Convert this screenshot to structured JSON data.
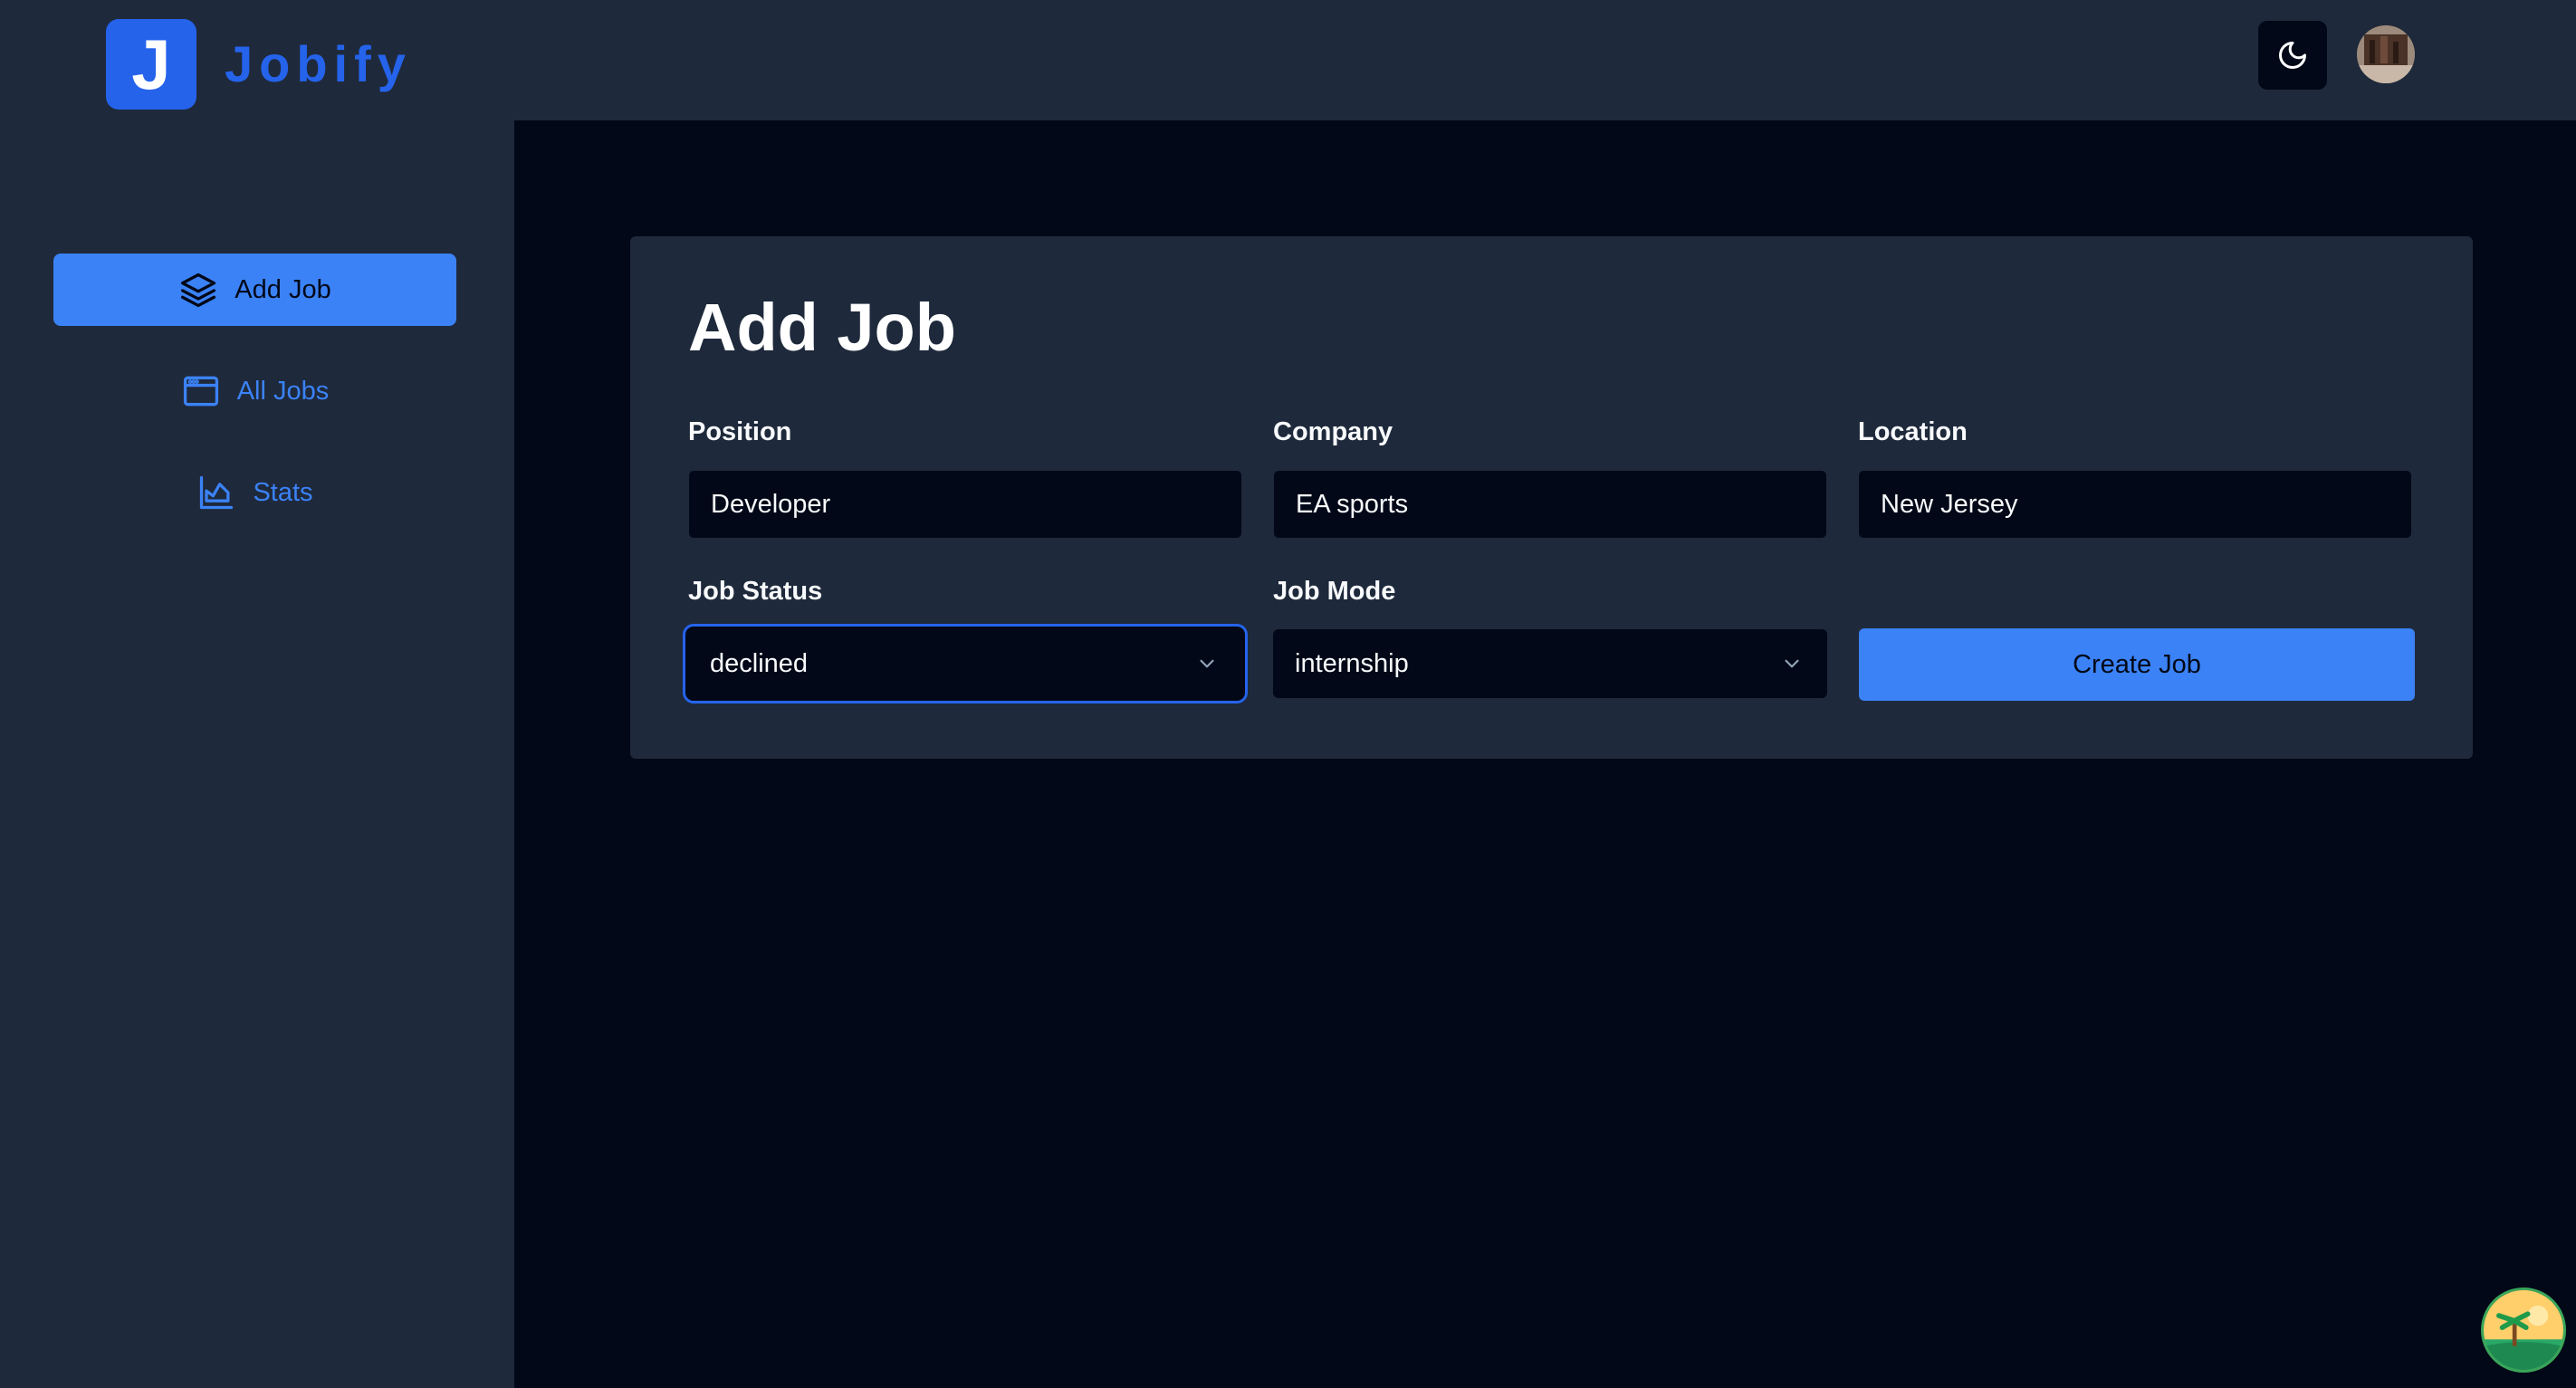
{
  "brand": {
    "logo_letter": "J",
    "name": "Jobify"
  },
  "header": {
    "theme_toggle_icon": "moon-icon",
    "avatar": "user-avatar"
  },
  "sidebar": {
    "items": [
      {
        "label": "Add Job",
        "icon": "layers-icon",
        "active": true
      },
      {
        "label": "All Jobs",
        "icon": "browser-window-icon",
        "active": false
      },
      {
        "label": "Stats",
        "icon": "area-chart-icon",
        "active": false
      }
    ]
  },
  "form": {
    "title": "Add Job",
    "position": {
      "label": "Position",
      "value": "Developer"
    },
    "company": {
      "label": "Company",
      "value": "EA sports"
    },
    "location": {
      "label": "Location",
      "value": "New Jersey"
    },
    "job_status": {
      "label": "Job Status",
      "value": "declined"
    },
    "job_mode": {
      "label": "Job Mode",
      "value": "internship"
    },
    "submit_label": "Create Job"
  },
  "colors": {
    "accent": "#3b82f6",
    "brand": "#2563eb",
    "panel": "#1e293b",
    "background": "#020817"
  }
}
